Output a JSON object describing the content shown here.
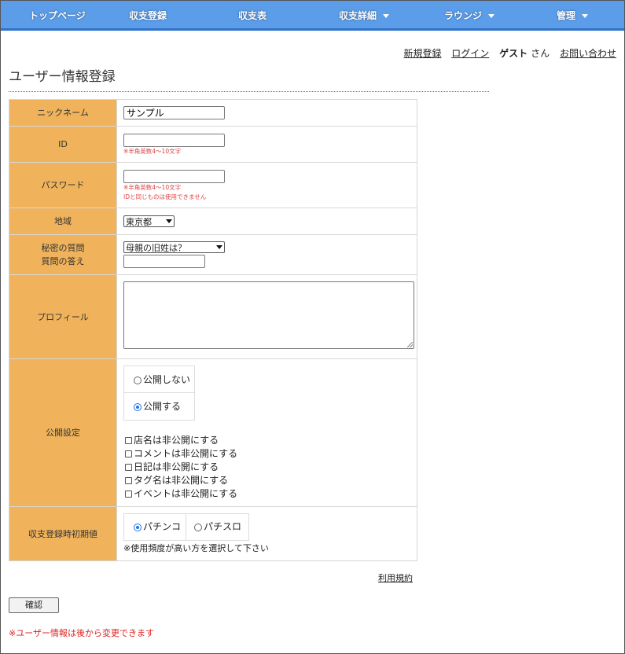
{
  "nav": {
    "items": [
      {
        "label": "トップページ",
        "dropdown": false
      },
      {
        "label": "収支登録",
        "dropdown": false
      },
      {
        "label": "収支表",
        "dropdown": false
      },
      {
        "label": "収支詳細",
        "dropdown": true
      },
      {
        "label": "ラウンジ",
        "dropdown": true
      },
      {
        "label": "管理",
        "dropdown": true
      }
    ]
  },
  "toplinks": {
    "register": "新規登録",
    "login": "ログイン",
    "guest": "ゲスト",
    "san": "さん",
    "contact": "お問い合わせ"
  },
  "page_title": "ユーザー情報登録",
  "form": {
    "nickname": {
      "label": "ニックネーム",
      "value": "サンプル"
    },
    "id": {
      "label": "ID",
      "value": "",
      "hint": "※半角英数4～10文字"
    },
    "password": {
      "label": "パスワード",
      "value": "",
      "hint1": "※半角英数4～10文字",
      "hint2": "IDと同じものは使用できません"
    },
    "region": {
      "label": "地域",
      "value": "東京都"
    },
    "secret": {
      "label1": "秘密の質問",
      "label2": "質問の答え",
      "question": "母親の旧姓は？",
      "answer": ""
    },
    "profile": {
      "label": "プロフィール",
      "value": ""
    },
    "publish": {
      "label": "公開設定",
      "private": "公開しない",
      "public": "公開する",
      "selected": "public",
      "checks": [
        "店名は非公開にする",
        "コメントは非公開にする",
        "日記は非公開にする",
        "タグ名は非公開にする",
        "イベントは非公開にする"
      ]
    },
    "initial": {
      "label": "収支登録時初期値",
      "pachinko": "パチンコ",
      "pachislo": "パチスロ",
      "selected": "pachinko",
      "note": "※使用頻度が高い方を選択して下さい"
    }
  },
  "terms": "利用規約",
  "confirm_button": "確認",
  "footer_note": "※ユーザー情報は後から変更できます",
  "colors": {
    "nav": "#5b9de9",
    "nav_border": "#2f73c9",
    "label_bg": "#f0b35c",
    "hint": "#dd4444"
  }
}
